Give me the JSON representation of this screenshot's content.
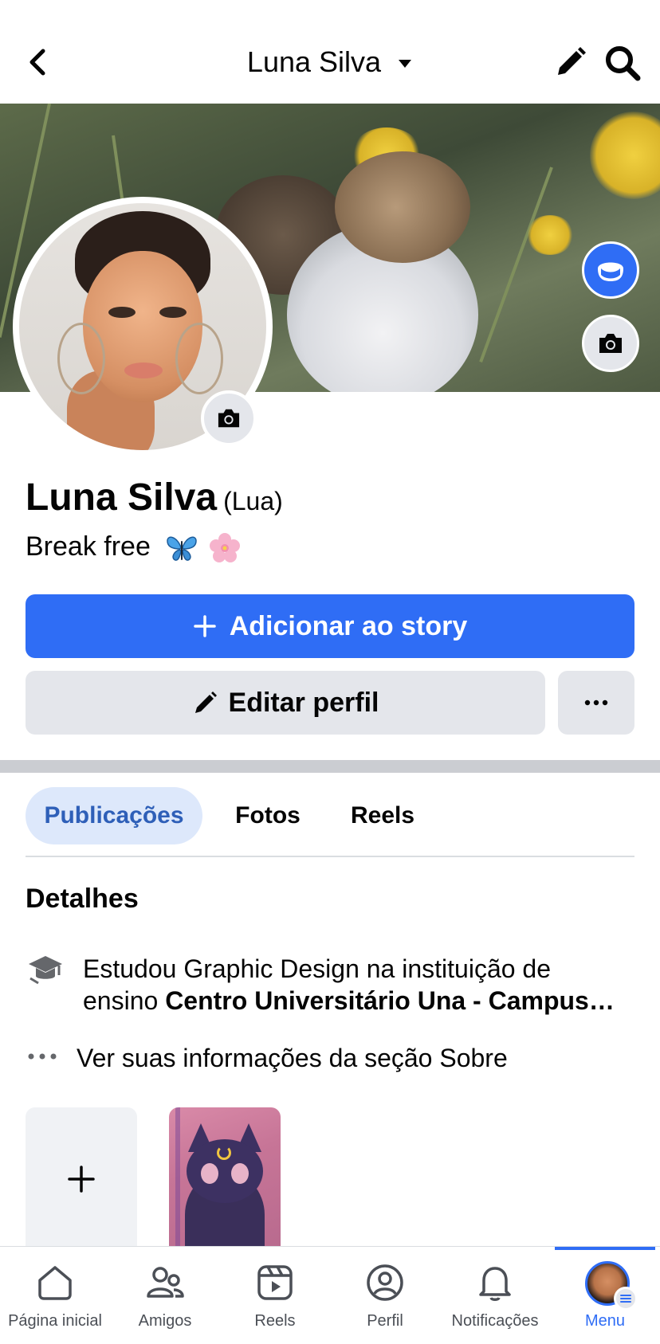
{
  "header": {
    "title": "Luna Silva",
    "icons": [
      "chevron-left-icon",
      "caret-down-icon",
      "pencil-icon",
      "search-icon"
    ]
  },
  "profile": {
    "name": "Luna Silva",
    "nickname": "(Lua)",
    "bio": "Break free",
    "bio_emojis": [
      "butterfly-emoji",
      "cherry-blossom-emoji"
    ]
  },
  "actions": {
    "add_story_label": "Adicionar ao story",
    "edit_profile_label": "Editar perfil"
  },
  "tabs": [
    {
      "label": "Publicações",
      "active": true
    },
    {
      "label": "Fotos",
      "active": false
    },
    {
      "label": "Reels",
      "active": false
    }
  ],
  "details": {
    "title": "Detalhes",
    "education_prefix": "Estudou Graphic Design na instituição de",
    "education_line2_prefix": "ensino ",
    "education_institution": "Centro Universitário Una - Campus…",
    "see_about": "Ver suas informações da seção Sobre"
  },
  "bottom_nav": [
    {
      "label": "Página inicial",
      "icon": "home-icon",
      "active": false
    },
    {
      "label": "Amigos",
      "icon": "friends-icon",
      "active": false
    },
    {
      "label": "Reels",
      "icon": "reels-icon",
      "active": false
    },
    {
      "label": "Perfil",
      "icon": "profile-icon",
      "active": false
    },
    {
      "label": "Notificações",
      "icon": "bell-icon",
      "active": false
    },
    {
      "label": "Menu",
      "icon": "menu-avatar-icon",
      "active": true
    }
  ],
  "colors": {
    "accent": "#2f6df5",
    "button_gray": "#e4e6eb",
    "tab_active_bg": "#dde8fb",
    "tab_active_text": "#2e5fb8"
  }
}
